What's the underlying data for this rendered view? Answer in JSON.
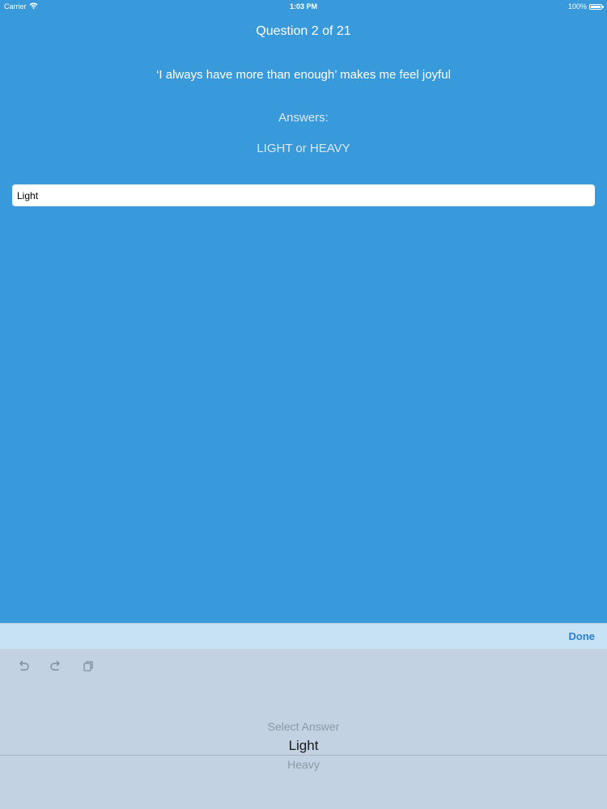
{
  "status_bar": {
    "carrier": "Carrier",
    "time": "1:03 PM",
    "battery": "100%"
  },
  "quiz": {
    "question_number": "Question 2 of 21",
    "question_text": "‘I always have more than enough’ makes me feel joyful",
    "answers_heading": "Answers:",
    "answers_options": "LIGHT or HEAVY"
  },
  "answer_field": {
    "value": "Light"
  },
  "toolbar": {
    "done_label": "Done"
  },
  "picker": {
    "options": [
      "Select Answer",
      "Light",
      "Heavy"
    ],
    "selected": "Light"
  },
  "colors": {
    "background": "#3899db",
    "accessory_bar": "#c8e2f5",
    "picker_panel": "#c3d2e2",
    "done": "#2a7fd4"
  },
  "icons": [
    "wifi-icon",
    "battery-icon",
    "undo-icon",
    "redo-icon",
    "paste-icon"
  ]
}
